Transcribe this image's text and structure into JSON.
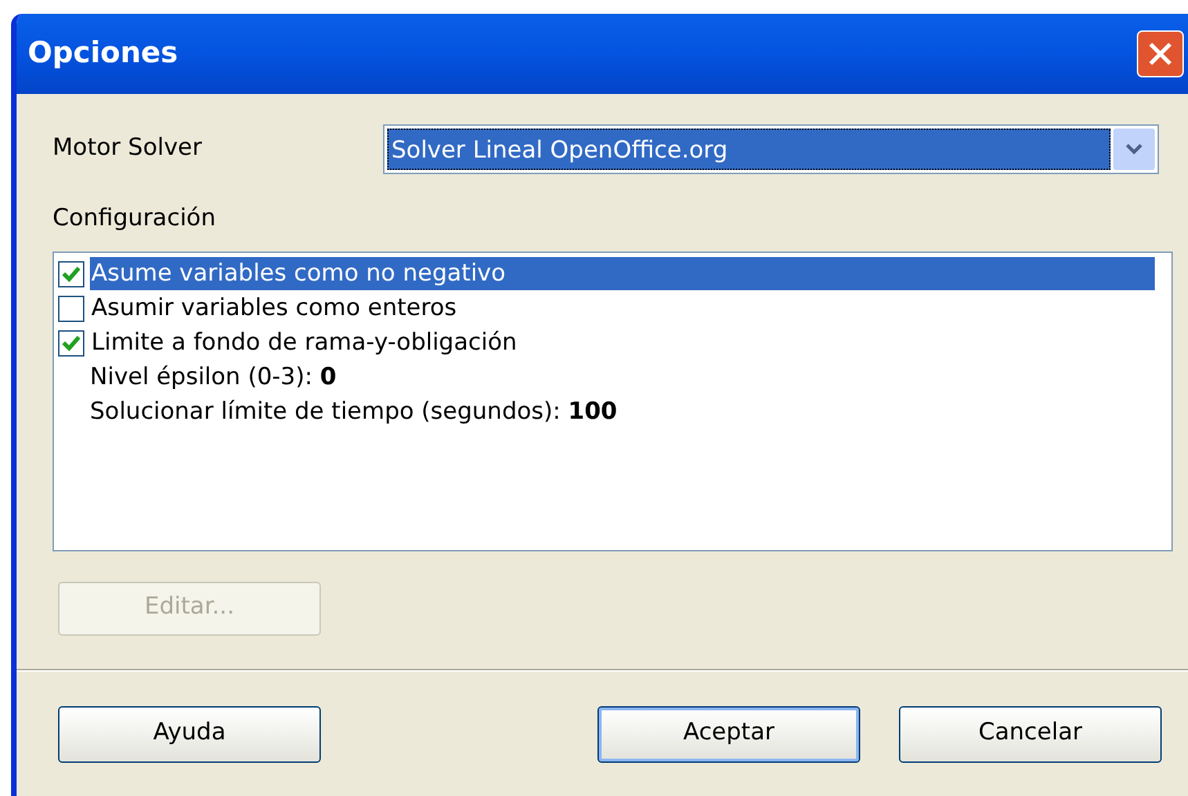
{
  "window": {
    "title": "Opciones"
  },
  "engine": {
    "label": "Motor Solver",
    "value": "Solver Lineal OpenOffice.org"
  },
  "settings": {
    "label": "Configuración",
    "items": [
      {
        "kind": "checkbox",
        "label": "Asume variables como no negativo",
        "checked": true,
        "selected": true
      },
      {
        "kind": "checkbox",
        "label": "Asumir variables como enteros",
        "checked": false,
        "selected": false
      },
      {
        "kind": "checkbox",
        "label": "Limite a fondo de rama-y-obligación",
        "checked": true,
        "selected": false
      },
      {
        "kind": "value",
        "label": "Nivel épsilon (0-3):",
        "value": "0",
        "selected": false
      },
      {
        "kind": "value",
        "label": "Solucionar límite de tiempo (segundos):",
        "value": "100",
        "selected": false
      }
    ]
  },
  "edit_button": {
    "label": "Editar...",
    "disabled": true
  },
  "buttons": [
    {
      "label": "Ayuda",
      "default": false
    },
    {
      "label": "Aceptar",
      "default": true
    },
    {
      "label": "Cancelar",
      "default": false
    }
  ]
}
